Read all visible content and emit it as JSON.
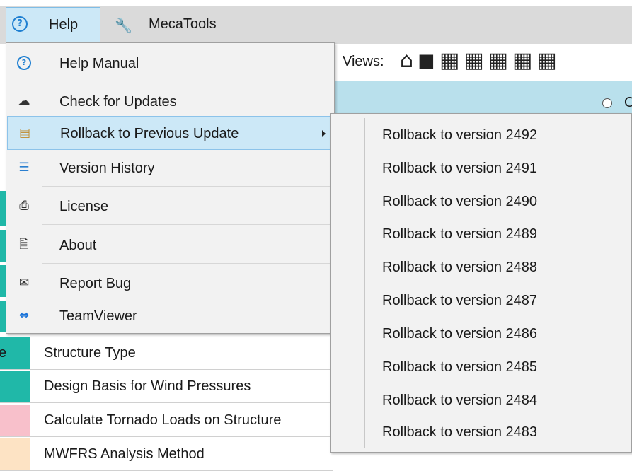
{
  "menubar": {
    "help_label": "Help",
    "mecatools_label": "MecaTools",
    "help_icon": "help-circle-icon",
    "mecatools_icon": "wrench-icon"
  },
  "toolbar": {
    "views_label": "Views:",
    "view_icons": [
      "home-icon",
      "cube-solid-icon",
      "cube-top-icon",
      "cube-front-icon",
      "cube-side-icon",
      "cube-back-icon",
      "cube-iso-icon"
    ]
  },
  "help_menu": {
    "items": [
      {
        "label": "Help Manual",
        "icon": "help-circle-icon"
      },
      {
        "label": "Check for Updates",
        "icon": "cloud-download-icon"
      },
      {
        "label": "Rollback to Previous Update",
        "icon": "folder-rollback-icon",
        "has_submenu": true
      },
      {
        "label": "Version History",
        "icon": "numbered-list-icon"
      },
      {
        "label": "License",
        "icon": "license-icon"
      },
      {
        "label": "About",
        "icon": "info-document-icon"
      },
      {
        "label": "Report Bug",
        "icon": "mail-bug-icon"
      },
      {
        "label": "TeamViewer",
        "icon": "teamviewer-icon"
      }
    ]
  },
  "rollback_submenu": {
    "items": [
      "Rollback to version 2492",
      "Rollback to version 2491",
      "Rollback to version 2490",
      "Rollback to version 2489",
      "Rollback to version 2488",
      "Rollback to version 2487",
      "Rollback to version 2486",
      "Rollback to version 2485",
      "Rollback to version 2484",
      "Rollback to version 2483"
    ]
  },
  "grid_rows": [
    {
      "prefix": "e",
      "label": "Structure Type",
      "color": "#20b8a8"
    },
    {
      "prefix": "",
      "label": "Design Basis for Wind Pressures",
      "color": "#20b8a8"
    },
    {
      "prefix": "",
      "label": "Calculate Tornado Loads on Structure",
      "color": "#f8c0cb"
    },
    {
      "prefix": "",
      "label": "MWFRS Analysis Method",
      "color": "#fde3c4"
    }
  ],
  "colors": {
    "accent_teal": "#20b8a8",
    "menu_highlight": "#cce8f7",
    "band_blue": "#b9e0ec"
  }
}
